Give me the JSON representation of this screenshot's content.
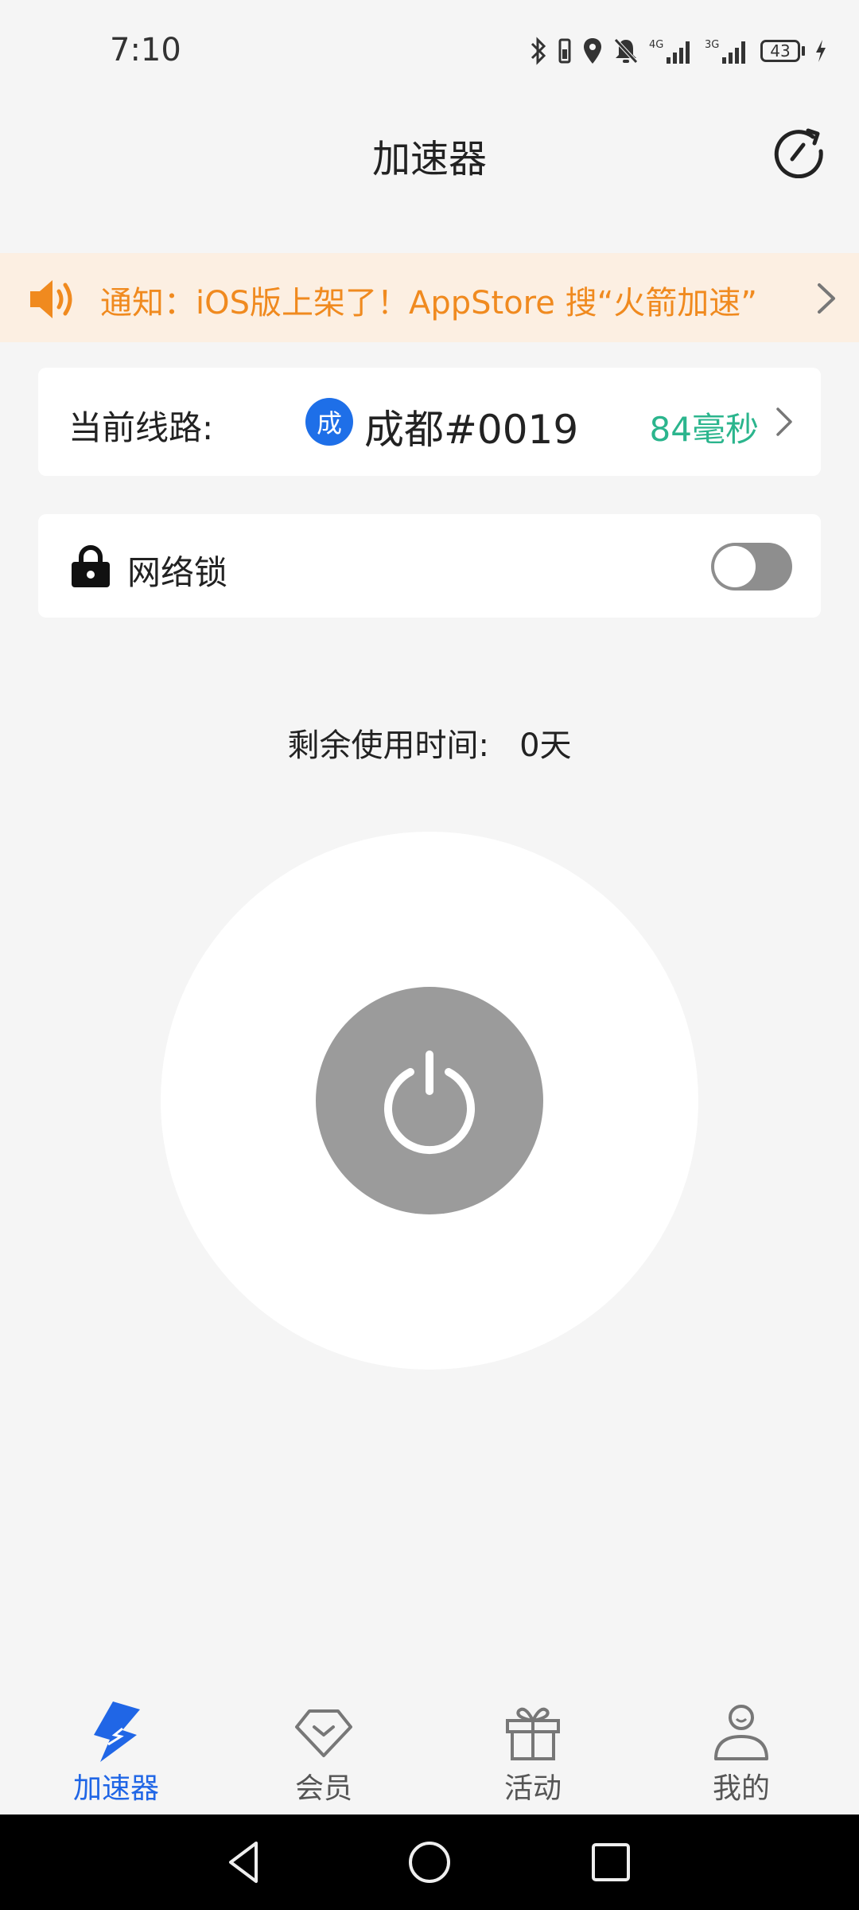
{
  "status_bar": {
    "time": "7:10",
    "battery": "43",
    "network_labels": [
      "4G",
      "3G"
    ]
  },
  "header": {
    "title": "加速器"
  },
  "notice": {
    "text": "通知：iOS版上架了！AppStore 搜“火箭加速”"
  },
  "route": {
    "label": "当前线路:",
    "badge": "成",
    "name": "成都#0019",
    "latency": "84毫秒"
  },
  "network_lock": {
    "label": "网络锁",
    "enabled": false
  },
  "remaining": {
    "text": "剩余使用时间:   0天"
  },
  "bottom_nav": {
    "items": [
      {
        "label": "加速器",
        "icon": "accelerator-icon",
        "active": true
      },
      {
        "label": "会员",
        "icon": "vip-icon",
        "active": false
      },
      {
        "label": "活动",
        "icon": "gift-icon",
        "active": false
      },
      {
        "label": "我的",
        "icon": "profile-icon",
        "active": false
      }
    ]
  },
  "colors": {
    "accent_blue": "#2066e6",
    "notice_orange": "#f08a1f",
    "latency_green": "#2bb58d",
    "notice_bg": "#fcefe2",
    "power_gray": "#9b9b9b"
  }
}
